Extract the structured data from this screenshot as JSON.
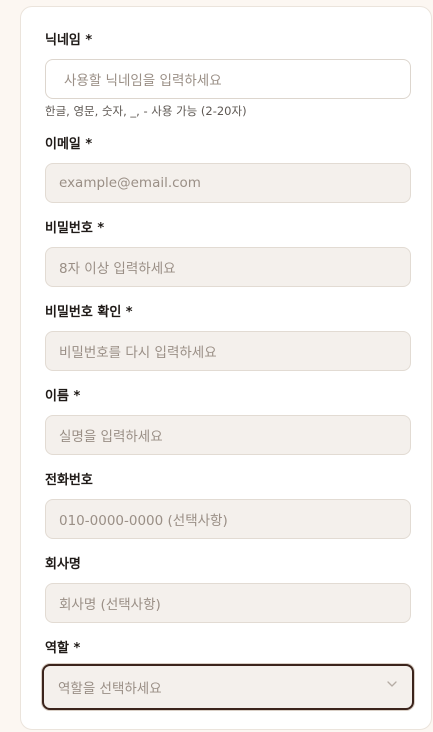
{
  "form": {
    "nickname": {
      "label": "닉네임 *",
      "placeholder": "사용할 닉네임을 입력하세요",
      "hint": "한글, 영문, 숫자, _, - 사용 가능 (2-20자)"
    },
    "email": {
      "label": "이메일 *",
      "placeholder": "example@email.com"
    },
    "password": {
      "label": "비밀번호 *",
      "placeholder": "8자 이상 입력하세요"
    },
    "password_confirm": {
      "label": "비밀번호 확인 *",
      "placeholder": "비밀번호를 다시 입력하세요"
    },
    "name": {
      "label": "이름 *",
      "placeholder": "실명을 입력하세요"
    },
    "phone": {
      "label": "전화번호",
      "placeholder": "010-0000-0000 (선택사항)"
    },
    "company": {
      "label": "회사명",
      "placeholder": "회사명 (선택사항)"
    },
    "role": {
      "label": "역할 *",
      "selected": "역할을 선택하세요",
      "icon": "chevron-down-icon"
    }
  },
  "colors": {
    "page_background": "#fcf7f2",
    "input_background": "#f4f0ec",
    "focus_border": "#3b241c",
    "label_text": "#1f1a17",
    "placeholder_text": "#9a8f86"
  }
}
